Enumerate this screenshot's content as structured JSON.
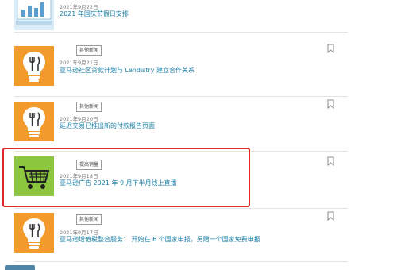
{
  "colors": {
    "title_link": "#1a7ea6",
    "highlight_border": "#e0282a",
    "thumb_orange": "#f39a2c",
    "thumb_green": "#8cc63f"
  },
  "articles": [
    {
      "date": "2021年9月22日",
      "title": "2021 年国庆节假日安排",
      "tag": "",
      "icon": "chart-dashboard-icon"
    },
    {
      "date": "2021年9月21日",
      "title": "亚马逊社区贷款计划与 Lendistry 建立合作关系",
      "tag": "其他新闻",
      "icon": "lightbulb-utensils-icon"
    },
    {
      "date": "2021年9月20日",
      "title": "延迟交易已推出新的付款报告页面",
      "tag": "其他新闻",
      "icon": "lightbulb-utensils-icon"
    },
    {
      "date": "2021年9月18日",
      "title": "亚马逊广告 2021 年 9 月下半月线上直播",
      "tag": "提高销量",
      "icon": "shopping-cart-icon"
    },
    {
      "date": "2021年9月17日",
      "title": "亚马逊增值税整合服务： 开始在 6 个国家申报，另赠一个国家免费申报",
      "tag": "其他新闻",
      "icon": "lightbulb-utensils-icon"
    }
  ]
}
